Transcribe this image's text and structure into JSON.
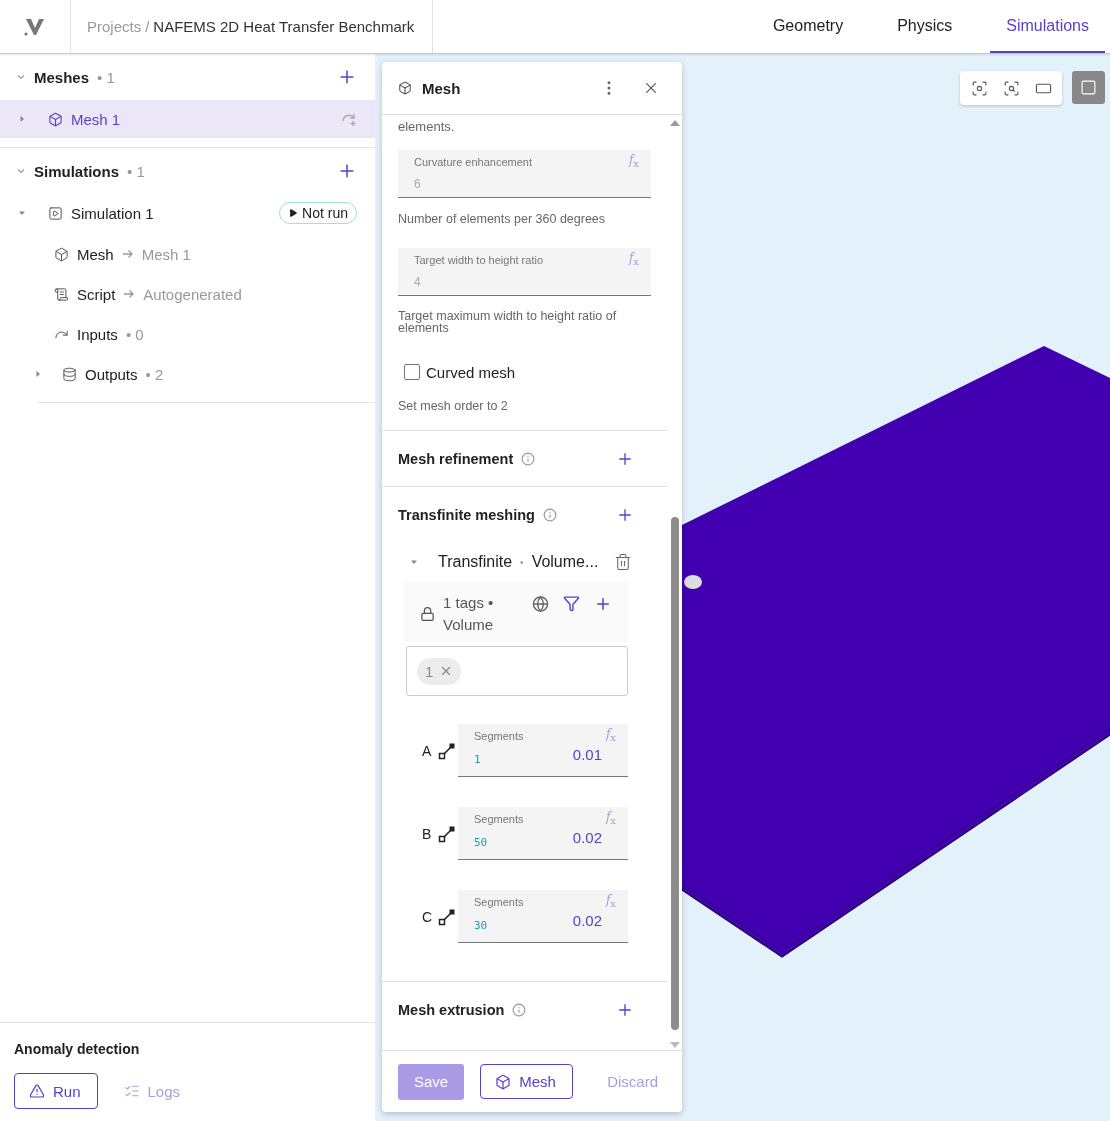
{
  "header": {
    "breadcrumb_root": "Projects",
    "breadcrumb_separator": "/",
    "project_title": "NAFEMS 2D Heat Transfer Benchmark",
    "tabs": [
      {
        "label": "Geometry",
        "selected": false
      },
      {
        "label": "Physics",
        "selected": false
      },
      {
        "label": "Simulations",
        "selected": true
      }
    ]
  },
  "sidebar": {
    "sections": [
      {
        "title": "Meshes",
        "count": "• 1",
        "expanded": true,
        "items": [
          {
            "kind": "mesh",
            "label": "Mesh 1",
            "selected": true,
            "expanded": false
          }
        ]
      },
      {
        "title": "Simulations",
        "count": "• 1",
        "expanded": true,
        "items": [
          {
            "kind": "simulation",
            "label": "Simulation 1",
            "status": "Not run",
            "selected": false,
            "expanded": true,
            "children": [
              {
                "kind": "mesh",
                "label": "Mesh",
                "target": "Mesh 1"
              },
              {
                "kind": "script",
                "label": "Script",
                "target": "Autogenerated"
              },
              {
                "kind": "inputs",
                "label": "Inputs",
                "count": "• 0"
              },
              {
                "kind": "outputs",
                "label": "Outputs",
                "count": "• 2",
                "expanded": false
              }
            ]
          }
        ]
      }
    ],
    "anomaly_detection": {
      "title": "Anomaly detection",
      "run_label": "Run",
      "logs_label": "Logs",
      "logs_disabled": true
    }
  },
  "viewport_toolbar": [
    {
      "kind": "focus",
      "selected": false
    },
    {
      "kind": "zoom",
      "selected": false
    },
    {
      "kind": "frame",
      "selected": false
    },
    {
      "kind": "view",
      "selected": true
    }
  ],
  "panel": {
    "title": "Mesh",
    "cut_text": "elements.",
    "fields": [
      {
        "label": "Curvature enhancement",
        "value": "6",
        "formula": "*f*$_{x}$",
        "help": "Number of elements per 360 degrees"
      },
      {
        "label": "Target width to height ratio",
        "value": "4",
        "formula": "*f*$_{x}$",
        "help": "Target maximum width to height ratio of elements"
      }
    ],
    "curved_mesh": {
      "label": "Curved mesh",
      "checked": false,
      "help": "Set mesh order to 2"
    },
    "sections": [
      {
        "title": "Mesh refinement"
      },
      {
        "title": "Transfinite meshing",
        "items": [
          {
            "title": "Transfinite",
            "separator": "•",
            "type": "Volume...",
            "expanded": true,
            "tags_summary": "1 tags •",
            "tags_kind": "Volume",
            "chips": [
              "1"
            ],
            "edges": [
              {
                "name": "A",
                "label": "Segments",
                "value": "1",
                "size": "0.01",
                "formula": "*f*$_{x}$"
              },
              {
                "name": "B",
                "label": "Segments",
                "value": "50",
                "size": "0.02",
                "formula": "*f*$_{x}$"
              },
              {
                "name": "C",
                "label": "Segments",
                "value": "30",
                "size": "0.02",
                "formula": "*f*$_{x}$"
              }
            ]
          }
        ]
      },
      {
        "title": "Mesh extrusion"
      }
    ],
    "buttons": {
      "save": "Save",
      "save_disabled": true,
      "mesh": "Mesh",
      "discard": "Discard",
      "discard_disabled": true
    }
  }
}
